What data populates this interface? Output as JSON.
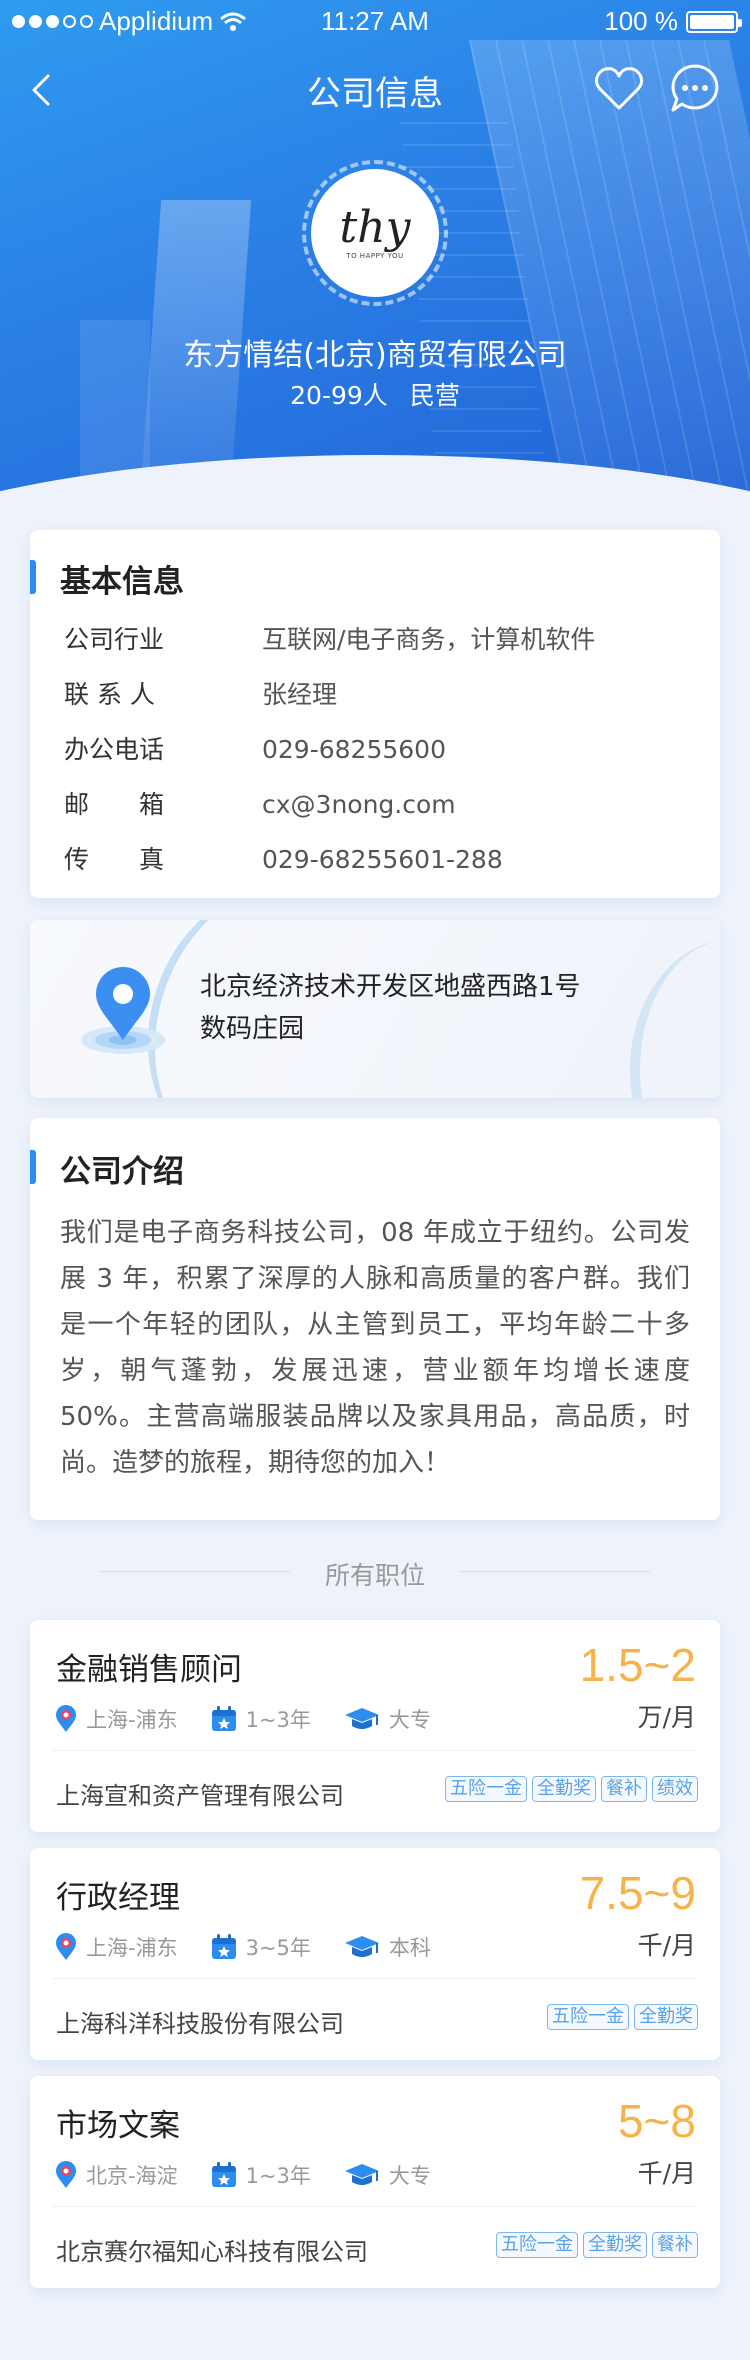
{
  "status_bar": {
    "carrier": "Applidium",
    "time": "11:27 AM",
    "battery": "100 %"
  },
  "nav": {
    "title": "公司信息"
  },
  "company": {
    "logo_text": "thy",
    "logo_sub": "TO HAPPY YOU",
    "name": "东方情结(北京)商贸有限公司",
    "size": "20-99人",
    "type": "民营"
  },
  "basic_info": {
    "title": "基本信息",
    "rows": [
      {
        "label": "公司行业",
        "value": "互联网/电子商务，计算机软件"
      },
      {
        "label": "联 系 人",
        "value": "张经理"
      },
      {
        "label": "办公电话",
        "value": "029-68255600"
      },
      {
        "label": "邮　　箱",
        "value": "cx@3nong.com"
      },
      {
        "label": "传　　真",
        "value": "029-68255601-288"
      }
    ]
  },
  "address": {
    "line1": "北京经济技术开发区地盛西路1号",
    "line2": "数码庄园"
  },
  "intro": {
    "title": "公司介绍",
    "text": "我们是电子商务科技公司，08 年成立于纽约。公司发展 3 年，积累了深厚的人脉和高质量的客户群。我们是一个年轻的团队，从主管到员工，平均年龄二十多岁，朝气蓬勃，发展迅速，营业额年均增长速度 50%。主营高端服装品牌以及家具用品，高品质，时尚。造梦的旅程，期待您的加入！"
  },
  "jobs_divider": "所有职位",
  "jobs": [
    {
      "title": "金融销售顾问",
      "salary": "1.5~2",
      "unit": "万/月",
      "location": "上海-浦东",
      "experience": "1~3年",
      "education": "大专",
      "company": "上海宣和资产管理有限公司",
      "tags": [
        "五险一金",
        "全勤奖",
        "餐补",
        "绩效"
      ]
    },
    {
      "title": "行政经理",
      "salary": "7.5~9",
      "unit": "千/月",
      "location": "上海-浦东",
      "experience": "3~5年",
      "education": "本科",
      "company": "上海科洋科技股份有限公司",
      "tags": [
        "五险一金",
        "全勤奖"
      ]
    },
    {
      "title": "市场文案",
      "salary": "5~8",
      "unit": "千/月",
      "location": "北京-海淀",
      "experience": "1~3年",
      "education": "大专",
      "company": "北京赛尔福知心科技有限公司",
      "tags": [
        "五险一金",
        "全勤奖",
        "餐补"
      ]
    }
  ],
  "colors": {
    "accent": "#2d8cf0",
    "salary": "#f8b24a",
    "tag": "#5aa1e8"
  }
}
